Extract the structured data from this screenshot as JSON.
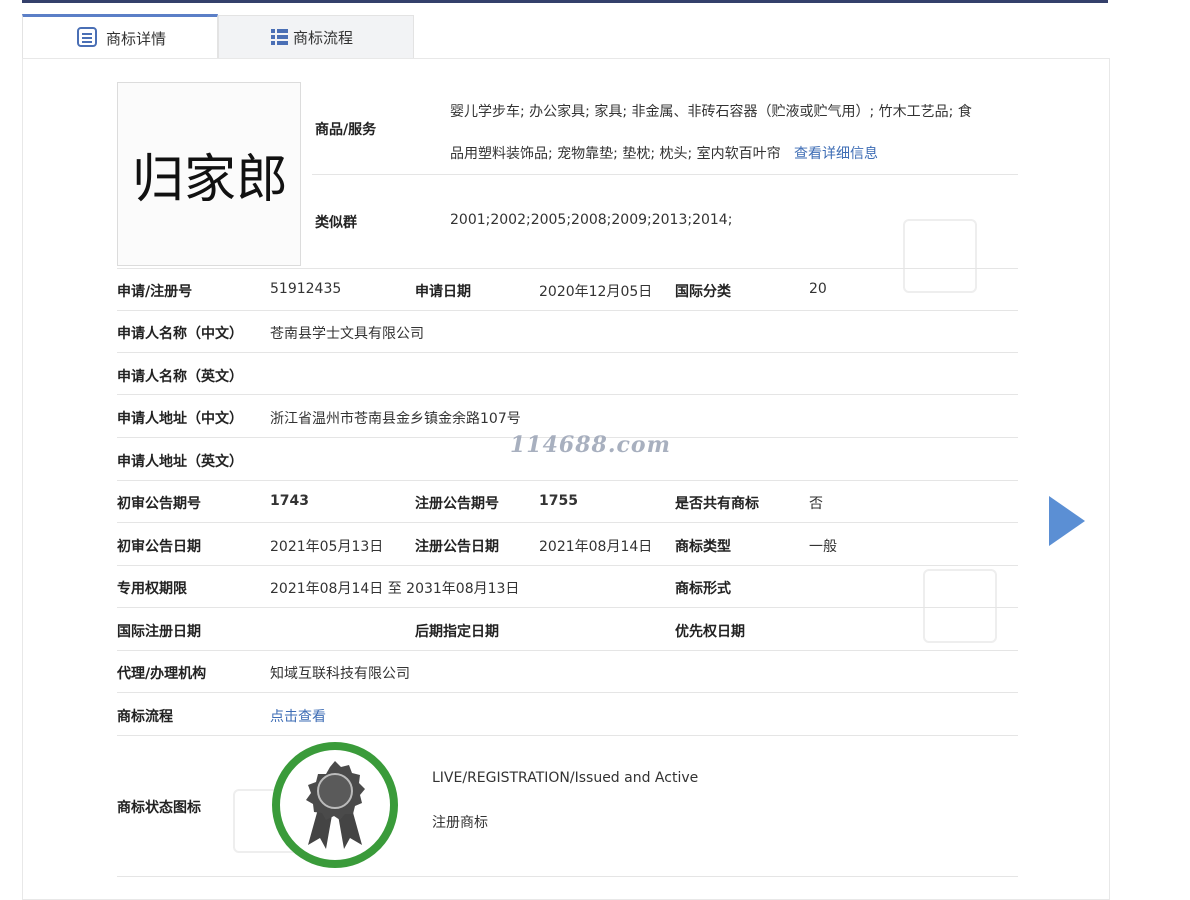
{
  "tabs": [
    {
      "label": "商标详情",
      "icon": "list-detail-icon"
    },
    {
      "label": "商标流程",
      "icon": "list-grid-icon"
    }
  ],
  "trademark": {
    "logo_text": "归家郎",
    "goods_label": "商品/服务",
    "goods_line1": "婴儿学步车; 办公家具; 家具; 非金属、非砖石容器（贮液或贮气用）; 竹木工艺品; 食",
    "goods_line2": "品用塑料装饰品; 宠物靠垫; 垫枕; 枕头; 室内软百叶帘",
    "goods_more_link": "查看详细信息",
    "similar_label": "类似群",
    "similar_value": "2001;2002;2005;2008;2009;2013;2014;"
  },
  "rows": {
    "reg_no_label": "申请/注册号",
    "reg_no": "51912435",
    "apply_date_label": "申请日期",
    "apply_date": "2020年12月05日",
    "intl_class_label": "国际分类",
    "intl_class": "20",
    "applicant_cn_label": "申请人名称（中文）",
    "applicant_cn": "苍南县学士文具有限公司",
    "applicant_en_label": "申请人名称（英文）",
    "address_cn_label": "申请人地址（中文）",
    "address_cn": "浙江省温州市苍南县金乡镇金余路107号",
    "address_en_label": "申请人地址（英文）",
    "prelim_no_label": "初审公告期号",
    "prelim_no": "1743",
    "reg_ann_no_label": "注册公告期号",
    "reg_ann_no": "1755",
    "shared_label": "是否共有商标",
    "shared": "否",
    "prelim_date_label": "初审公告日期",
    "prelim_date": "2021年05月13日",
    "reg_ann_date_label": "注册公告日期",
    "reg_ann_date": "2021年08月14日",
    "tm_type_label": "商标类型",
    "tm_type": "一般",
    "exclusive_label": "专用权期限",
    "exclusive": "2021年08月14日 至 2031年08月13日",
    "tm_form_label": "商标形式",
    "intl_reg_date_label": "国际注册日期",
    "later_date_label": "后期指定日期",
    "priority_label": "优先权日期",
    "agent_label": "代理/办理机构",
    "agent": "知域互联科技有限公司",
    "flow_label": "商标流程",
    "flow_link": "点击查看",
    "status_label": "商标状态图标",
    "status_en": "LIVE/REGISTRATION/Issued and Active",
    "status_cn": "注册商标"
  },
  "watermark_text": "114688.com",
  "colors": {
    "accent": "#5b7fc7",
    "link": "#3e6db5",
    "badge_green": "#3a9b3a",
    "arrow": "#5b8fd4"
  }
}
